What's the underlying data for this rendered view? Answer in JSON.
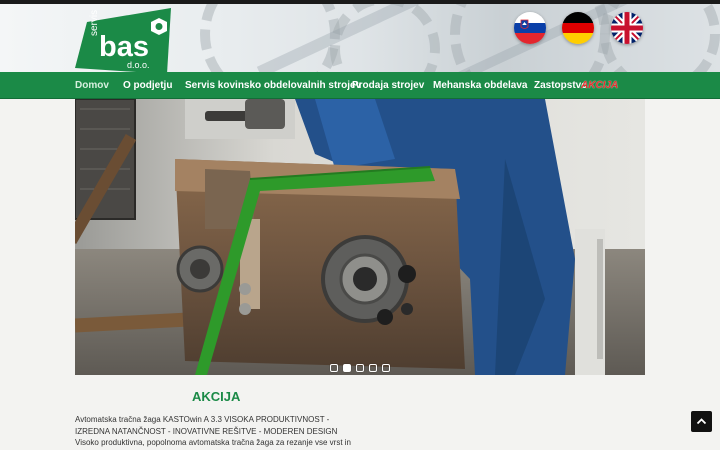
{
  "brand": {
    "logo_top": "servis",
    "logo_main": "bas",
    "logo_bottom": "d.o.o."
  },
  "languages": [
    {
      "name": "flag-slovenia",
      "colors": [
        "#ffffff",
        "#0a3fa8",
        "#e3262e"
      ]
    },
    {
      "name": "flag-germany",
      "colors": [
        "#000000",
        "#dd0000",
        "#ffce00"
      ]
    },
    {
      "name": "flag-uk",
      "colors": [
        "#012169",
        "#ffffff",
        "#c8102e"
      ]
    }
  ],
  "nav": {
    "items": [
      {
        "label": "Domov"
      },
      {
        "label": "O podjetju"
      },
      {
        "label": "Servis kovinsko obdelovalnih strojev"
      },
      {
        "label": "Prodaja strojev"
      },
      {
        "label": "Mehanska obdelava"
      },
      {
        "label": "Zastopstvo"
      }
    ],
    "badge": "AKCIJA"
  },
  "slider": {
    "dot_count": 5,
    "active_dot": 2
  },
  "promo": {
    "title": "AKCIJA",
    "text": "Avtomatska tračna žaga KASTOwin A 3.3 VISOKA PRODUKTIVNOST - IZREDNA NATANČNOST - INOVATIVNE REŠITVE - MODEREN DESIGN Visoko produktivna, popolnoma avtomatska tračna žaga za rezanje vse vrst in kvalitet"
  },
  "colors": {
    "brand_green": "#1b8a47",
    "badge_red": "#e53030",
    "text": "#333333"
  },
  "icons": {
    "scroll_top": "chevron-up-icon",
    "logo_bolt": "hex-nut-icon"
  }
}
